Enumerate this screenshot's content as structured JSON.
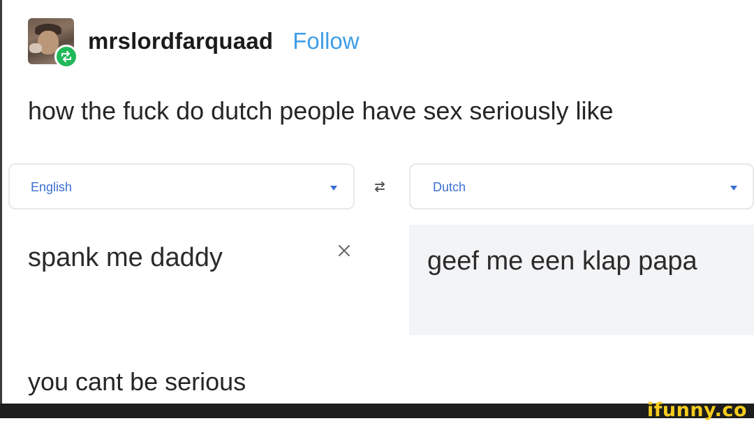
{
  "post": {
    "username": "mrslordfarquaad",
    "follow_label": "Follow",
    "text_top": "how the fuck do dutch people have sex seriously like",
    "text_bottom": "you cant be serious"
  },
  "translator": {
    "source_language": "English",
    "target_language": "Dutch",
    "source_text": "spank me daddy",
    "translated_text": "geef me een klap papa"
  },
  "watermark": "ifunny.co",
  "icons": [
    "avatar",
    "reblog-icon",
    "chevron-down-icon",
    "swap-icon",
    "close-icon"
  ],
  "colors": {
    "follow": "#3e9ee8",
    "language_label": "#3b6fd4",
    "reblog_badge": "#21b85a",
    "translation_bg": "#f3f4f6",
    "watermark": "#f5cc1c"
  }
}
